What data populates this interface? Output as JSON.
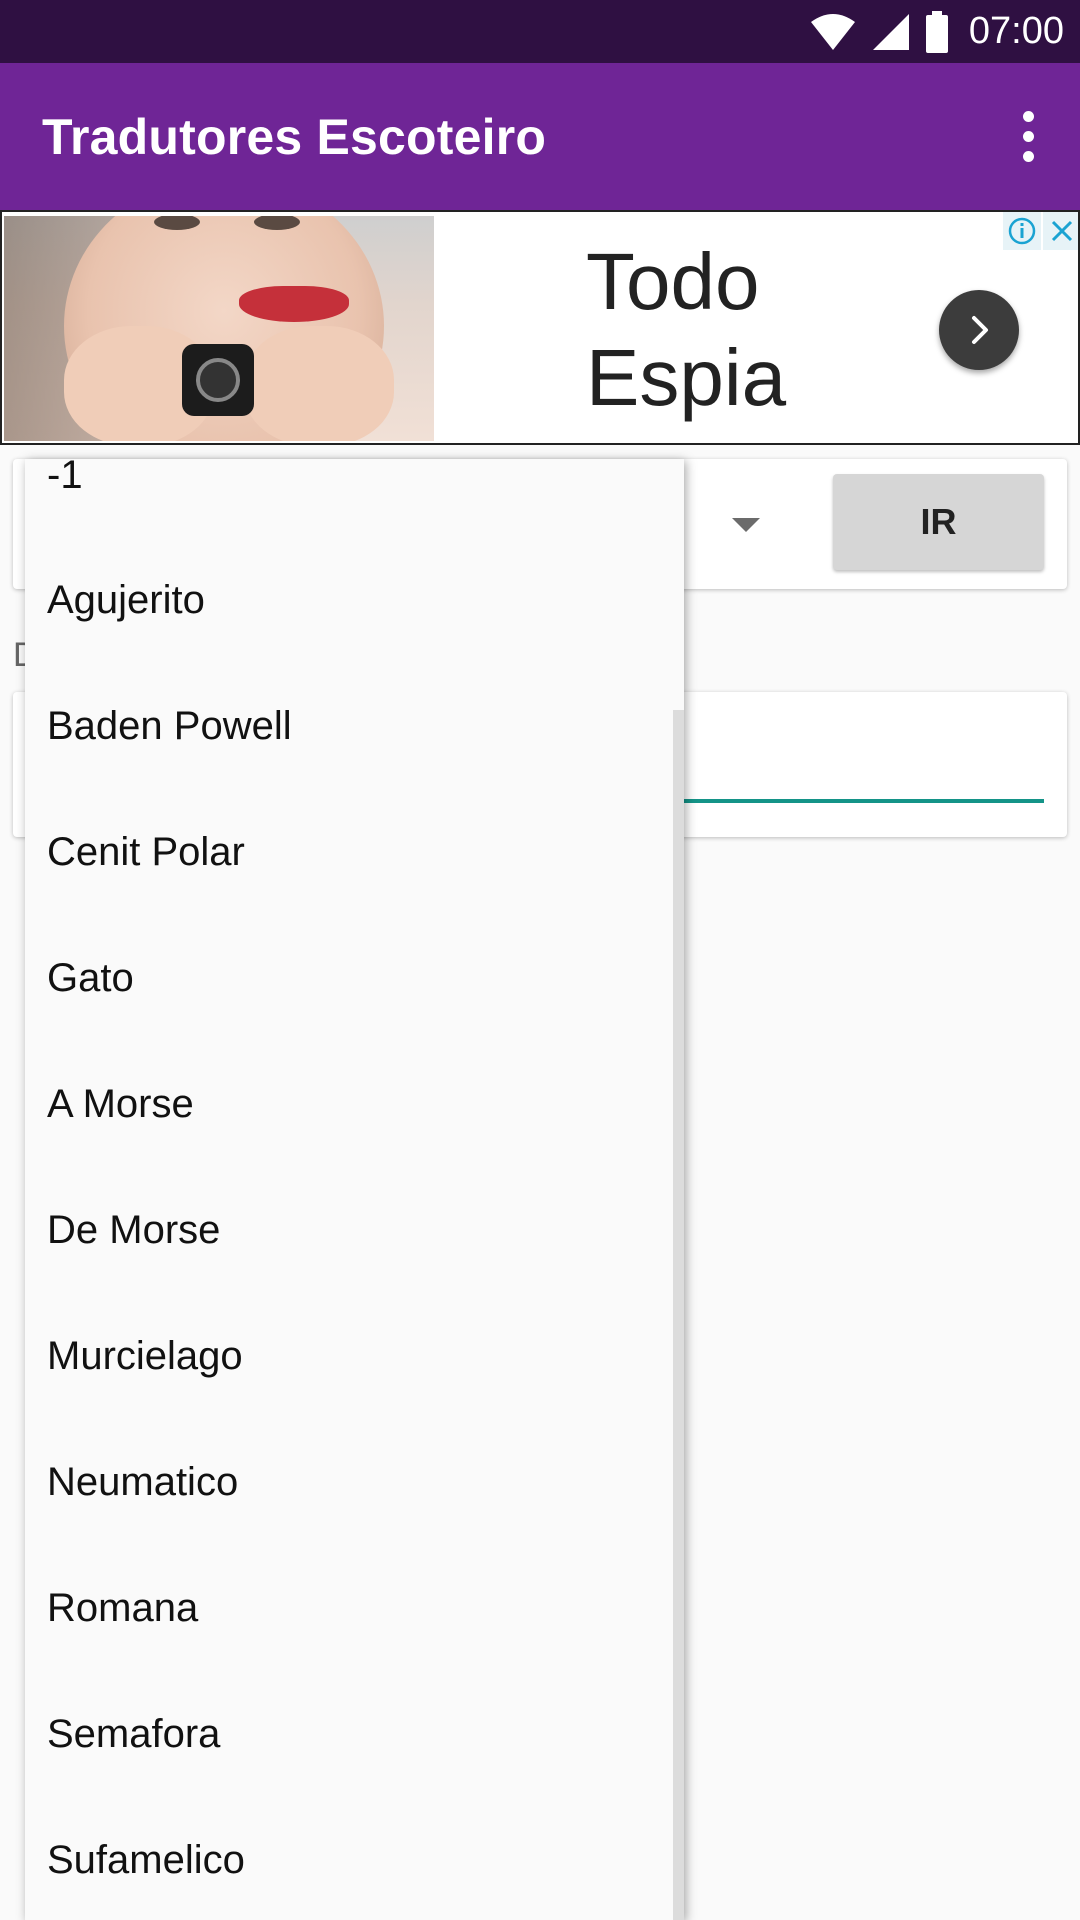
{
  "status_bar": {
    "time": "07:00",
    "icons": [
      "wifi-icon",
      "signal-icon",
      "battery-icon"
    ]
  },
  "app_bar": {
    "title": "Tradutores Escoteiro",
    "menu_icon": "overflow-menu-icon"
  },
  "ad": {
    "headline_line1": "Todo",
    "headline_line2": "Espia",
    "info_icon": "info-icon",
    "close_icon": "close-icon",
    "arrow_icon": "chevron-right-icon"
  },
  "form": {
    "go_button_label": "IR",
    "section_label_partial": "D"
  },
  "dropdown": {
    "items": [
      "-1",
      "Agujerito",
      "Baden Powell",
      "Cenit Polar",
      "Gato",
      "A Morse",
      "De Morse",
      "Murcielago",
      "Neumatico",
      "Romana",
      "Semafora",
      "Sufamelico"
    ]
  },
  "colors": {
    "status_bar": "#2f1042",
    "app_bar": "#6f2596",
    "accent": "#149488"
  }
}
